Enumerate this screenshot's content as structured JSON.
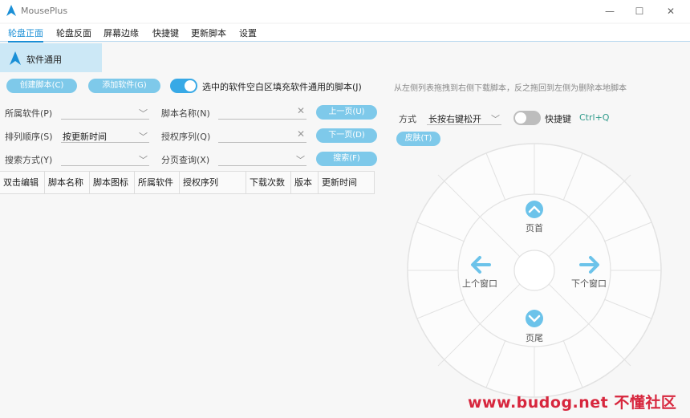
{
  "app": {
    "title": "MousePlus",
    "min": "—",
    "max": "☐",
    "close": "✕"
  },
  "tabs": [
    {
      "label": "轮盘正面"
    },
    {
      "label": "轮盘反面"
    },
    {
      "label": "屏幕边缘"
    },
    {
      "label": "快捷键"
    },
    {
      "label": "更新脚本"
    },
    {
      "label": "设置"
    }
  ],
  "sidebar": {
    "category": "软件通用"
  },
  "toolbar": {
    "create": "创建脚本(C)",
    "add_software": "添加软件(G)",
    "toggle_label": "选中的软件空白区填充软件通用的脚本(J)",
    "hint": "从左侧列表拖拽到右侧下载脚本，反之拖回到左侧为删除本地脚本"
  },
  "filters": {
    "software_label": "所属软件(P)",
    "software_value": "",
    "script_name_label": "脚本名称(N)",
    "script_name_value": "",
    "prev_page": "上一页(U)",
    "sort_label": "排列顺序(S)",
    "sort_value": "按更新时间",
    "auth_label": "授权序列(Q)",
    "auth_value": "",
    "next_page": "下一页(D)",
    "search_mode_label": "搜索方式(Y)",
    "search_mode_value": "",
    "page_query_label": "分页查询(X)",
    "page_query_value": "",
    "search": "搜索(F)"
  },
  "table": {
    "columns": [
      "双击编辑",
      "脚本名称",
      "脚本图标",
      "所属软件",
      "授权序列",
      "下载次数",
      "版本",
      "更新时间"
    ]
  },
  "wheel_settings": {
    "mode_label": "方式",
    "mode_value": "长按右键松开",
    "shortcut_label": "快捷键",
    "shortcut_value": "Ctrl+Q",
    "skin": "皮肤(T)"
  },
  "wheel": {
    "top": "页首",
    "left": "上个窗口",
    "right": "下个窗口",
    "bottom": "页尾"
  },
  "watermark": "www.budog.net 不懂社区",
  "colors": {
    "accent": "#1a8fd6",
    "button": "#7ec9ea",
    "wheel_icon": "#6cc3ea"
  }
}
